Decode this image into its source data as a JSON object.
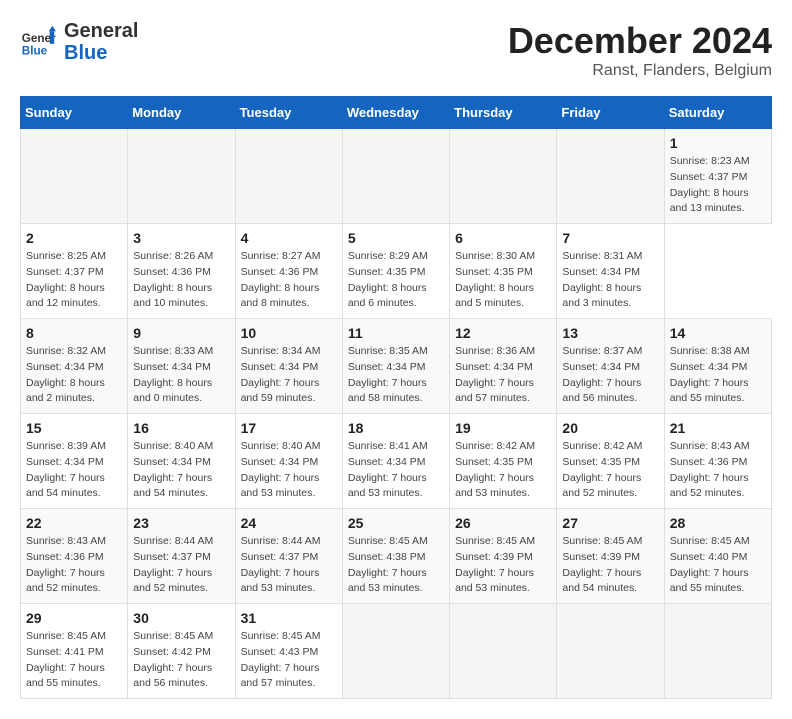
{
  "header": {
    "logo_general": "General",
    "logo_blue": "Blue",
    "month_title": "December 2024",
    "location": "Ranst, Flanders, Belgium"
  },
  "calendar": {
    "days_of_week": [
      "Sunday",
      "Monday",
      "Tuesday",
      "Wednesday",
      "Thursday",
      "Friday",
      "Saturday"
    ],
    "weeks": [
      [
        null,
        null,
        null,
        null,
        null,
        null,
        {
          "day": "1",
          "sunrise": "Sunrise: 8:23 AM",
          "sunset": "Sunset: 4:37 PM",
          "daylight": "Daylight: 8 hours and 13 minutes."
        }
      ],
      [
        {
          "day": "2",
          "sunrise": "Sunrise: 8:25 AM",
          "sunset": "Sunset: 4:37 PM",
          "daylight": "Daylight: 8 hours and 12 minutes."
        },
        {
          "day": "3",
          "sunrise": "Sunrise: 8:26 AM",
          "sunset": "Sunset: 4:36 PM",
          "daylight": "Daylight: 8 hours and 10 minutes."
        },
        {
          "day": "4",
          "sunrise": "Sunrise: 8:27 AM",
          "sunset": "Sunset: 4:36 PM",
          "daylight": "Daylight: 8 hours and 8 minutes."
        },
        {
          "day": "5",
          "sunrise": "Sunrise: 8:29 AM",
          "sunset": "Sunset: 4:35 PM",
          "daylight": "Daylight: 8 hours and 6 minutes."
        },
        {
          "day": "6",
          "sunrise": "Sunrise: 8:30 AM",
          "sunset": "Sunset: 4:35 PM",
          "daylight": "Daylight: 8 hours and 5 minutes."
        },
        {
          "day": "7",
          "sunrise": "Sunrise: 8:31 AM",
          "sunset": "Sunset: 4:34 PM",
          "daylight": "Daylight: 8 hours and 3 minutes."
        }
      ],
      [
        {
          "day": "8",
          "sunrise": "Sunrise: 8:32 AM",
          "sunset": "Sunset: 4:34 PM",
          "daylight": "Daylight: 8 hours and 2 minutes."
        },
        {
          "day": "9",
          "sunrise": "Sunrise: 8:33 AM",
          "sunset": "Sunset: 4:34 PM",
          "daylight": "Daylight: 8 hours and 0 minutes."
        },
        {
          "day": "10",
          "sunrise": "Sunrise: 8:34 AM",
          "sunset": "Sunset: 4:34 PM",
          "daylight": "Daylight: 7 hours and 59 minutes."
        },
        {
          "day": "11",
          "sunrise": "Sunrise: 8:35 AM",
          "sunset": "Sunset: 4:34 PM",
          "daylight": "Daylight: 7 hours and 58 minutes."
        },
        {
          "day": "12",
          "sunrise": "Sunrise: 8:36 AM",
          "sunset": "Sunset: 4:34 PM",
          "daylight": "Daylight: 7 hours and 57 minutes."
        },
        {
          "day": "13",
          "sunrise": "Sunrise: 8:37 AM",
          "sunset": "Sunset: 4:34 PM",
          "daylight": "Daylight: 7 hours and 56 minutes."
        },
        {
          "day": "14",
          "sunrise": "Sunrise: 8:38 AM",
          "sunset": "Sunset: 4:34 PM",
          "daylight": "Daylight: 7 hours and 55 minutes."
        }
      ],
      [
        {
          "day": "15",
          "sunrise": "Sunrise: 8:39 AM",
          "sunset": "Sunset: 4:34 PM",
          "daylight": "Daylight: 7 hours and 54 minutes."
        },
        {
          "day": "16",
          "sunrise": "Sunrise: 8:40 AM",
          "sunset": "Sunset: 4:34 PM",
          "daylight": "Daylight: 7 hours and 54 minutes."
        },
        {
          "day": "17",
          "sunrise": "Sunrise: 8:40 AM",
          "sunset": "Sunset: 4:34 PM",
          "daylight": "Daylight: 7 hours and 53 minutes."
        },
        {
          "day": "18",
          "sunrise": "Sunrise: 8:41 AM",
          "sunset": "Sunset: 4:34 PM",
          "daylight": "Daylight: 7 hours and 53 minutes."
        },
        {
          "day": "19",
          "sunrise": "Sunrise: 8:42 AM",
          "sunset": "Sunset: 4:35 PM",
          "daylight": "Daylight: 7 hours and 53 minutes."
        },
        {
          "day": "20",
          "sunrise": "Sunrise: 8:42 AM",
          "sunset": "Sunset: 4:35 PM",
          "daylight": "Daylight: 7 hours and 52 minutes."
        },
        {
          "day": "21",
          "sunrise": "Sunrise: 8:43 AM",
          "sunset": "Sunset: 4:36 PM",
          "daylight": "Daylight: 7 hours and 52 minutes."
        }
      ],
      [
        {
          "day": "22",
          "sunrise": "Sunrise: 8:43 AM",
          "sunset": "Sunset: 4:36 PM",
          "daylight": "Daylight: 7 hours and 52 minutes."
        },
        {
          "day": "23",
          "sunrise": "Sunrise: 8:44 AM",
          "sunset": "Sunset: 4:37 PM",
          "daylight": "Daylight: 7 hours and 52 minutes."
        },
        {
          "day": "24",
          "sunrise": "Sunrise: 8:44 AM",
          "sunset": "Sunset: 4:37 PM",
          "daylight": "Daylight: 7 hours and 53 minutes."
        },
        {
          "day": "25",
          "sunrise": "Sunrise: 8:45 AM",
          "sunset": "Sunset: 4:38 PM",
          "daylight": "Daylight: 7 hours and 53 minutes."
        },
        {
          "day": "26",
          "sunrise": "Sunrise: 8:45 AM",
          "sunset": "Sunset: 4:39 PM",
          "daylight": "Daylight: 7 hours and 53 minutes."
        },
        {
          "day": "27",
          "sunrise": "Sunrise: 8:45 AM",
          "sunset": "Sunset: 4:39 PM",
          "daylight": "Daylight: 7 hours and 54 minutes."
        },
        {
          "day": "28",
          "sunrise": "Sunrise: 8:45 AM",
          "sunset": "Sunset: 4:40 PM",
          "daylight": "Daylight: 7 hours and 55 minutes."
        }
      ],
      [
        {
          "day": "29",
          "sunrise": "Sunrise: 8:45 AM",
          "sunset": "Sunset: 4:41 PM",
          "daylight": "Daylight: 7 hours and 55 minutes."
        },
        {
          "day": "30",
          "sunrise": "Sunrise: 8:45 AM",
          "sunset": "Sunset: 4:42 PM",
          "daylight": "Daylight: 7 hours and 56 minutes."
        },
        {
          "day": "31",
          "sunrise": "Sunrise: 8:45 AM",
          "sunset": "Sunset: 4:43 PM",
          "daylight": "Daylight: 7 hours and 57 minutes."
        },
        null,
        null,
        null,
        null
      ]
    ]
  }
}
